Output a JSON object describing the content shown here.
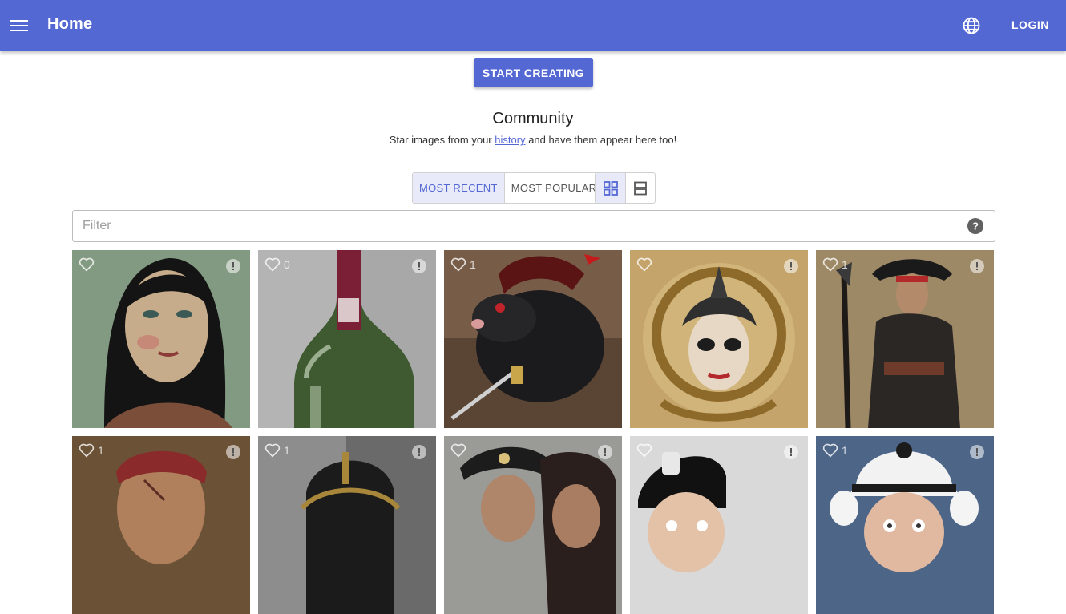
{
  "appbar": {
    "title": "Home",
    "login_label": "LOGIN",
    "menu_icon": "hamburger-menu-icon",
    "language_icon": "globe-icon"
  },
  "hero": {
    "start_label": "START CREATING"
  },
  "community": {
    "title": "Community",
    "subtitle_before": "Star images from your",
    "subtitle_link": "history",
    "subtitle_after": "and have them appear here too!"
  },
  "sort_tabs": [
    {
      "label": "MOST RECENT",
      "active": true
    },
    {
      "label": "MOST POPULAR",
      "active": false
    }
  ],
  "view_modes": [
    {
      "icon": "grid-view-icon",
      "active": true
    },
    {
      "icon": "list-view-icon",
      "active": false
    }
  ],
  "filter": {
    "placeholder": "Filter",
    "value": "",
    "help_icon": "help-circle-icon"
  },
  "colors": {
    "accent": "#5468d4",
    "accent_light": "#e8eafa"
  },
  "images": [
    {
      "likes": "",
      "subject": "painted woman portrait"
    },
    {
      "likes": "0",
      "subject": "green wine bottle"
    },
    {
      "likes": "1",
      "subject": "pirate rat with sword"
    },
    {
      "likes": "",
      "subject": "pirate skull emblem"
    },
    {
      "likes": "1",
      "subject": "pirate captain full body"
    },
    {
      "likes": "1",
      "subject": "pirate with bandana"
    },
    {
      "likes": "1",
      "subject": "crowned figure"
    },
    {
      "likes": "",
      "subject": "two pirates"
    },
    {
      "likes": "",
      "subject": "police officer cap"
    },
    {
      "likes": "1",
      "subject": "officer white helmet"
    }
  ]
}
